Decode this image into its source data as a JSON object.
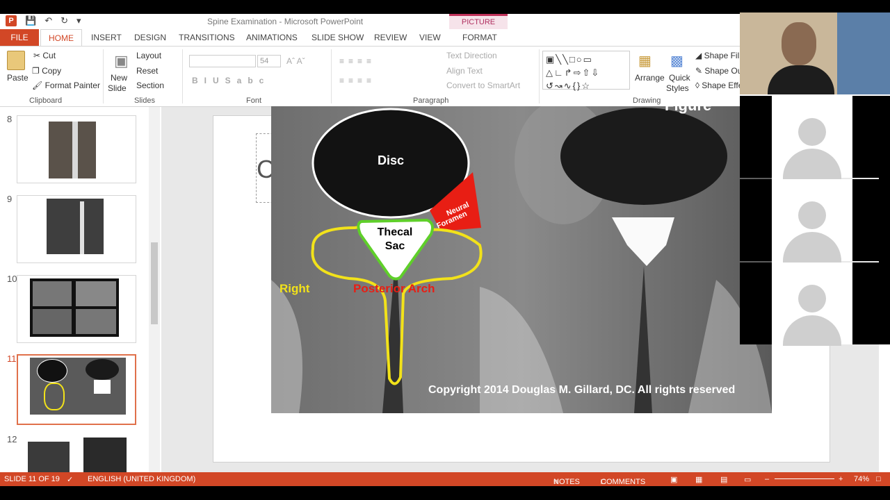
{
  "window": {
    "title": "Spine Examination - Microsoft PowerPoint",
    "context_tab_group": "PICTURE TOOLS"
  },
  "tabs": [
    "FILE",
    "HOME",
    "INSERT",
    "DESIGN",
    "TRANSITIONS",
    "ANIMATIONS",
    "SLIDE SHOW",
    "REVIEW",
    "VIEW",
    "FORMAT"
  ],
  "ribbon": {
    "clipboard": {
      "paste": "Paste",
      "cut": "Cut",
      "copy": "Copy",
      "format_painter": "Format Painter",
      "label": "Clipboard"
    },
    "slides": {
      "new_slide": "New",
      "new_slide_2": "Slide",
      "layout": "Layout",
      "reset": "Reset",
      "section": "Section",
      "label": "Slides"
    },
    "font": {
      "size": "54",
      "label": "Font"
    },
    "paragraph": {
      "text_direction": "Text Direction",
      "align_text": "Align Text",
      "convert_smartart": "Convert to SmartArt",
      "label": "Paragraph"
    },
    "drawing": {
      "arrange": "Arrange",
      "quick_styles_1": "Quick",
      "quick_styles_2": "Styles",
      "shape_fill": "Shape Fill",
      "shape_outline": "Shape Ou",
      "shape_effects": "Shape Effe",
      "label": "Drawing"
    }
  },
  "thumbnails": [
    {
      "num": "8"
    },
    {
      "num": "9"
    },
    {
      "num": "10"
    },
    {
      "num": "11"
    },
    {
      "num": "12"
    }
  ],
  "slide": {
    "placeholder_char": "C",
    "figure_partial": "Figure",
    "labels": {
      "disc": "Disc",
      "thecal_sac_1": "Thecal",
      "thecal_sac_2": "Sac",
      "neural_foramen_1": "Neural",
      "neural_foramen_2": "Foramen",
      "right": "Right",
      "posterior_arch": "Posterior Arch",
      "copyright": "Copyright 2014 Douglas M. Gillard, DC. All rights reserved"
    }
  },
  "status": {
    "slide_info": "SLIDE 11 OF 19",
    "language": "ENGLISH (UNITED KINGDOM)",
    "notes": "NOTES",
    "comments": "COMMENTS",
    "zoom": "74%"
  },
  "colors": {
    "accent": "#d24726",
    "outline_yellow": "#f2e21a",
    "outline_green": "#5fcf2a",
    "foramen_red": "#e81e14"
  }
}
